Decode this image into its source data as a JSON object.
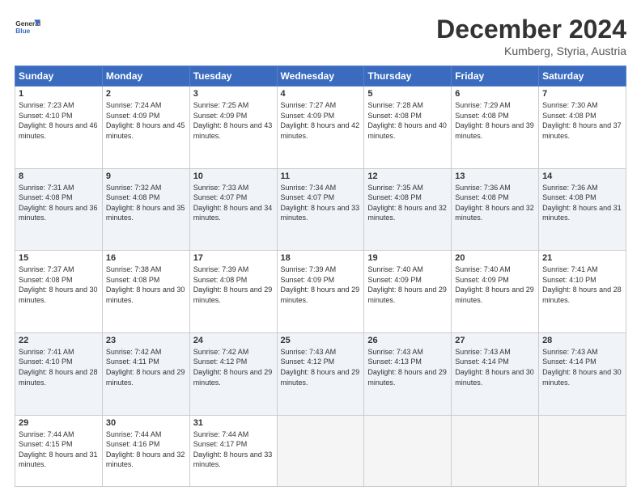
{
  "header": {
    "logo_line1": "General",
    "logo_line2": "Blue",
    "month": "December 2024",
    "location": "Kumberg, Styria, Austria"
  },
  "days_of_week": [
    "Sunday",
    "Monday",
    "Tuesday",
    "Wednesday",
    "Thursday",
    "Friday",
    "Saturday"
  ],
  "weeks": [
    [
      {
        "day": 1,
        "sunrise": "7:23 AM",
        "sunset": "4:10 PM",
        "daylight": "8 hours and 46 minutes."
      },
      {
        "day": 2,
        "sunrise": "7:24 AM",
        "sunset": "4:09 PM",
        "daylight": "8 hours and 45 minutes."
      },
      {
        "day": 3,
        "sunrise": "7:25 AM",
        "sunset": "4:09 PM",
        "daylight": "8 hours and 43 minutes."
      },
      {
        "day": 4,
        "sunrise": "7:27 AM",
        "sunset": "4:09 PM",
        "daylight": "8 hours and 42 minutes."
      },
      {
        "day": 5,
        "sunrise": "7:28 AM",
        "sunset": "4:08 PM",
        "daylight": "8 hours and 40 minutes."
      },
      {
        "day": 6,
        "sunrise": "7:29 AM",
        "sunset": "4:08 PM",
        "daylight": "8 hours and 39 minutes."
      },
      {
        "day": 7,
        "sunrise": "7:30 AM",
        "sunset": "4:08 PM",
        "daylight": "8 hours and 37 minutes."
      }
    ],
    [
      {
        "day": 8,
        "sunrise": "7:31 AM",
        "sunset": "4:08 PM",
        "daylight": "8 hours and 36 minutes."
      },
      {
        "day": 9,
        "sunrise": "7:32 AM",
        "sunset": "4:08 PM",
        "daylight": "8 hours and 35 minutes."
      },
      {
        "day": 10,
        "sunrise": "7:33 AM",
        "sunset": "4:07 PM",
        "daylight": "8 hours and 34 minutes."
      },
      {
        "day": 11,
        "sunrise": "7:34 AM",
        "sunset": "4:07 PM",
        "daylight": "8 hours and 33 minutes."
      },
      {
        "day": 12,
        "sunrise": "7:35 AM",
        "sunset": "4:08 PM",
        "daylight": "8 hours and 32 minutes."
      },
      {
        "day": 13,
        "sunrise": "7:36 AM",
        "sunset": "4:08 PM",
        "daylight": "8 hours and 32 minutes."
      },
      {
        "day": 14,
        "sunrise": "7:36 AM",
        "sunset": "4:08 PM",
        "daylight": "8 hours and 31 minutes."
      }
    ],
    [
      {
        "day": 15,
        "sunrise": "7:37 AM",
        "sunset": "4:08 PM",
        "daylight": "8 hours and 30 minutes."
      },
      {
        "day": 16,
        "sunrise": "7:38 AM",
        "sunset": "4:08 PM",
        "daylight": "8 hours and 30 minutes."
      },
      {
        "day": 17,
        "sunrise": "7:39 AM",
        "sunset": "4:08 PM",
        "daylight": "8 hours and 29 minutes."
      },
      {
        "day": 18,
        "sunrise": "7:39 AM",
        "sunset": "4:09 PM",
        "daylight": "8 hours and 29 minutes."
      },
      {
        "day": 19,
        "sunrise": "7:40 AM",
        "sunset": "4:09 PM",
        "daylight": "8 hours and 29 minutes."
      },
      {
        "day": 20,
        "sunrise": "7:40 AM",
        "sunset": "4:09 PM",
        "daylight": "8 hours and 29 minutes."
      },
      {
        "day": 21,
        "sunrise": "7:41 AM",
        "sunset": "4:10 PM",
        "daylight": "8 hours and 28 minutes."
      }
    ],
    [
      {
        "day": 22,
        "sunrise": "7:41 AM",
        "sunset": "4:10 PM",
        "daylight": "8 hours and 28 minutes."
      },
      {
        "day": 23,
        "sunrise": "7:42 AM",
        "sunset": "4:11 PM",
        "daylight": "8 hours and 29 minutes."
      },
      {
        "day": 24,
        "sunrise": "7:42 AM",
        "sunset": "4:12 PM",
        "daylight": "8 hours and 29 minutes."
      },
      {
        "day": 25,
        "sunrise": "7:43 AM",
        "sunset": "4:12 PM",
        "daylight": "8 hours and 29 minutes."
      },
      {
        "day": 26,
        "sunrise": "7:43 AM",
        "sunset": "4:13 PM",
        "daylight": "8 hours and 29 minutes."
      },
      {
        "day": 27,
        "sunrise": "7:43 AM",
        "sunset": "4:14 PM",
        "daylight": "8 hours and 30 minutes."
      },
      {
        "day": 28,
        "sunrise": "7:43 AM",
        "sunset": "4:14 PM",
        "daylight": "8 hours and 30 minutes."
      }
    ],
    [
      {
        "day": 29,
        "sunrise": "7:44 AM",
        "sunset": "4:15 PM",
        "daylight": "8 hours and 31 minutes."
      },
      {
        "day": 30,
        "sunrise": "7:44 AM",
        "sunset": "4:16 PM",
        "daylight": "8 hours and 32 minutes."
      },
      {
        "day": 31,
        "sunrise": "7:44 AM",
        "sunset": "4:17 PM",
        "daylight": "8 hours and 33 minutes."
      },
      null,
      null,
      null,
      null
    ]
  ]
}
